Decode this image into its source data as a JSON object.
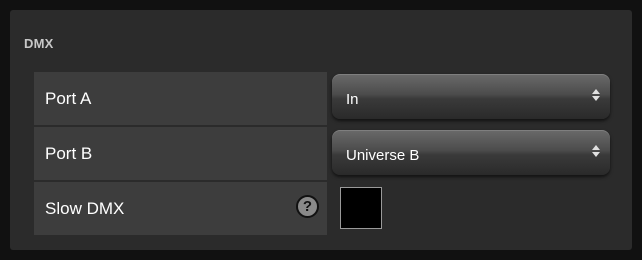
{
  "section": {
    "title": "DMX"
  },
  "rows": [
    {
      "label": "Port A",
      "control": "select",
      "value": "In"
    },
    {
      "label": "Port B",
      "control": "select",
      "value": "Universe B"
    },
    {
      "label": "Slow DMX",
      "control": "checkbox",
      "checked": false,
      "help_icon": "question-circle-icon"
    }
  ],
  "colors": {
    "panel": "#2b2b2b",
    "label_bg": "#3d3d3d",
    "text": "#ffffff"
  }
}
